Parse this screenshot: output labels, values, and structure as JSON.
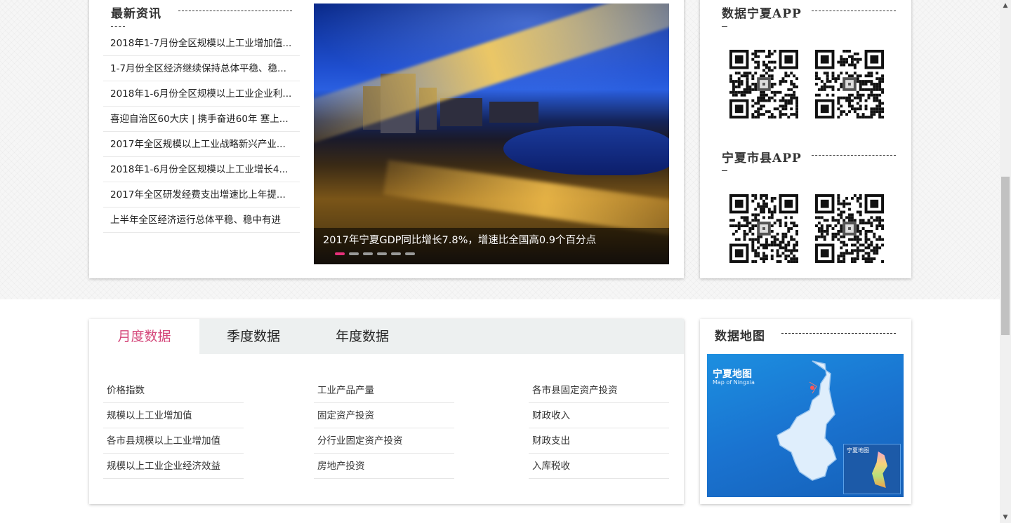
{
  "news": {
    "title": "最新资讯",
    "items": [
      "2018年1-7月份全区规模以上工业增加值...",
      "1-7月份全区经济继续保持总体平稳、稳...",
      "2018年1-6月份全区规模以上工业企业利...",
      "喜迎自治区60大庆 | 携手奋进60年 塞上...",
      "2017年全区规模以上工业战略新兴产业...",
      "2018年1-6月份全区规模以上工业增长4...",
      "2017年全区研发经费支出增速比上年提...",
      "上半年全区经济运行总体平稳、稳中有进"
    ]
  },
  "slider": {
    "caption": "2017年宁夏GDP同比增长7.8%，增速比全国高0.9个百分点",
    "dots": 6,
    "active_dot": 0
  },
  "apps": {
    "ningxia_title": "数据宁夏APP",
    "counties_title": "宁夏市县APP"
  },
  "tabs": {
    "monthly": "月度数据",
    "quarterly": "季度数据",
    "annual": "年度数据",
    "active": "monthly"
  },
  "links": {
    "col1": [
      "价格指数",
      "规模以上工业增加值",
      "各市县规模以上工业增加值",
      "规模以上工业企业经济效益"
    ],
    "col2": [
      "工业产品产量",
      "固定资产投资",
      "分行业固定资产投资",
      "房地产投资"
    ],
    "col3": [
      "各市县固定资产投资",
      "财政收入",
      "财政支出",
      "入库税收"
    ]
  },
  "map": {
    "title": "数据地图",
    "image_title": "宁夏地图",
    "image_subtitle": "Map of Ningxia",
    "inset_title": "宁夏地图"
  },
  "colors": {
    "accent": "#d4477a",
    "dot_active": "#e5307a",
    "tab_bar": "#edf0f0"
  }
}
